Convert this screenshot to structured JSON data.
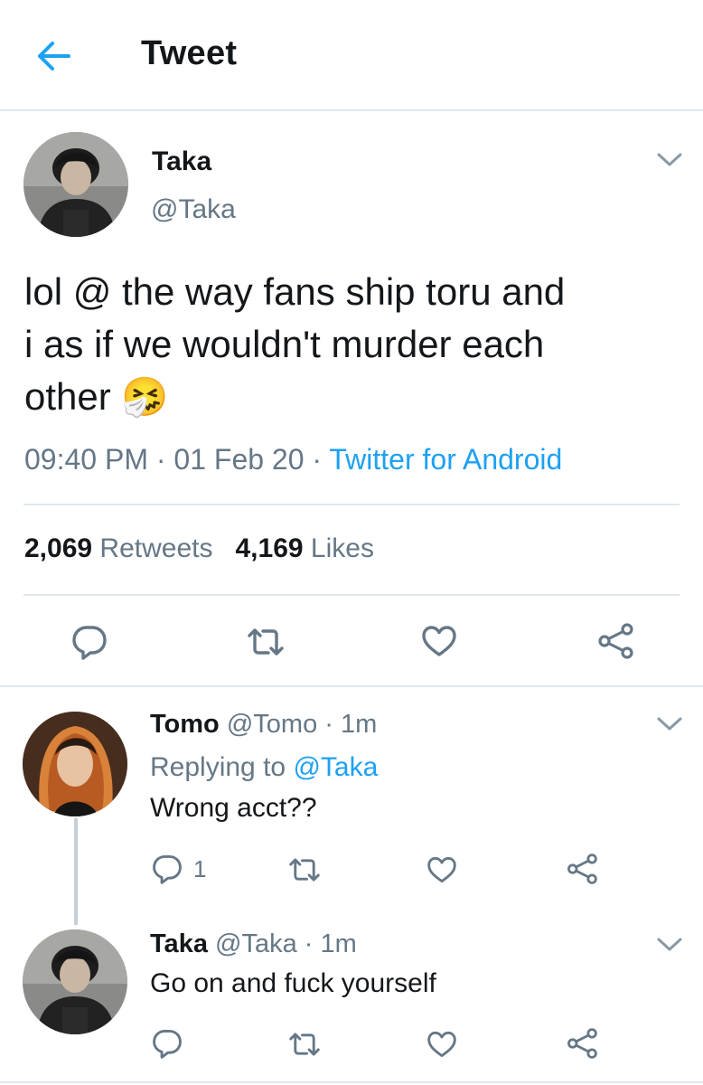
{
  "header": {
    "title": "Tweet"
  },
  "main_tweet": {
    "author_name": "Taka",
    "author_handle": "@Taka",
    "text_line1": "lol @ the way fans ship toru and",
    "text_line2": "i as if we wouldn't murder each",
    "text_line3": "other",
    "emoji": "🤧",
    "time": "09:40 PM",
    "date": "01 Feb 20",
    "source": "Twitter for Android",
    "separator": "·",
    "retweet_count": "2,069",
    "retweet_label": "Retweets",
    "like_count": "4,169",
    "like_label": "Likes"
  },
  "replies": [
    {
      "name": "Tomo",
      "handle": "@Tomo",
      "time": "1m",
      "replying_prefix": "Replying to",
      "replying_handle": "@Taka",
      "text": "Wrong acct??",
      "reply_count": "1"
    },
    {
      "name": "Taka",
      "handle": "@Taka",
      "time": "1m",
      "text": "Go on and fuck yourself"
    }
  ],
  "icons": {
    "back": "arrow-left-icon",
    "chevron": "chevron-down-icon",
    "reply": "speech-bubble-icon",
    "retweet": "retweet-icon",
    "like": "heart-icon",
    "share": "share-icon"
  },
  "colors": {
    "accent": "#1da1f2",
    "text": "#14171a",
    "secondary": "#657786",
    "divider": "#e1e8ed"
  }
}
